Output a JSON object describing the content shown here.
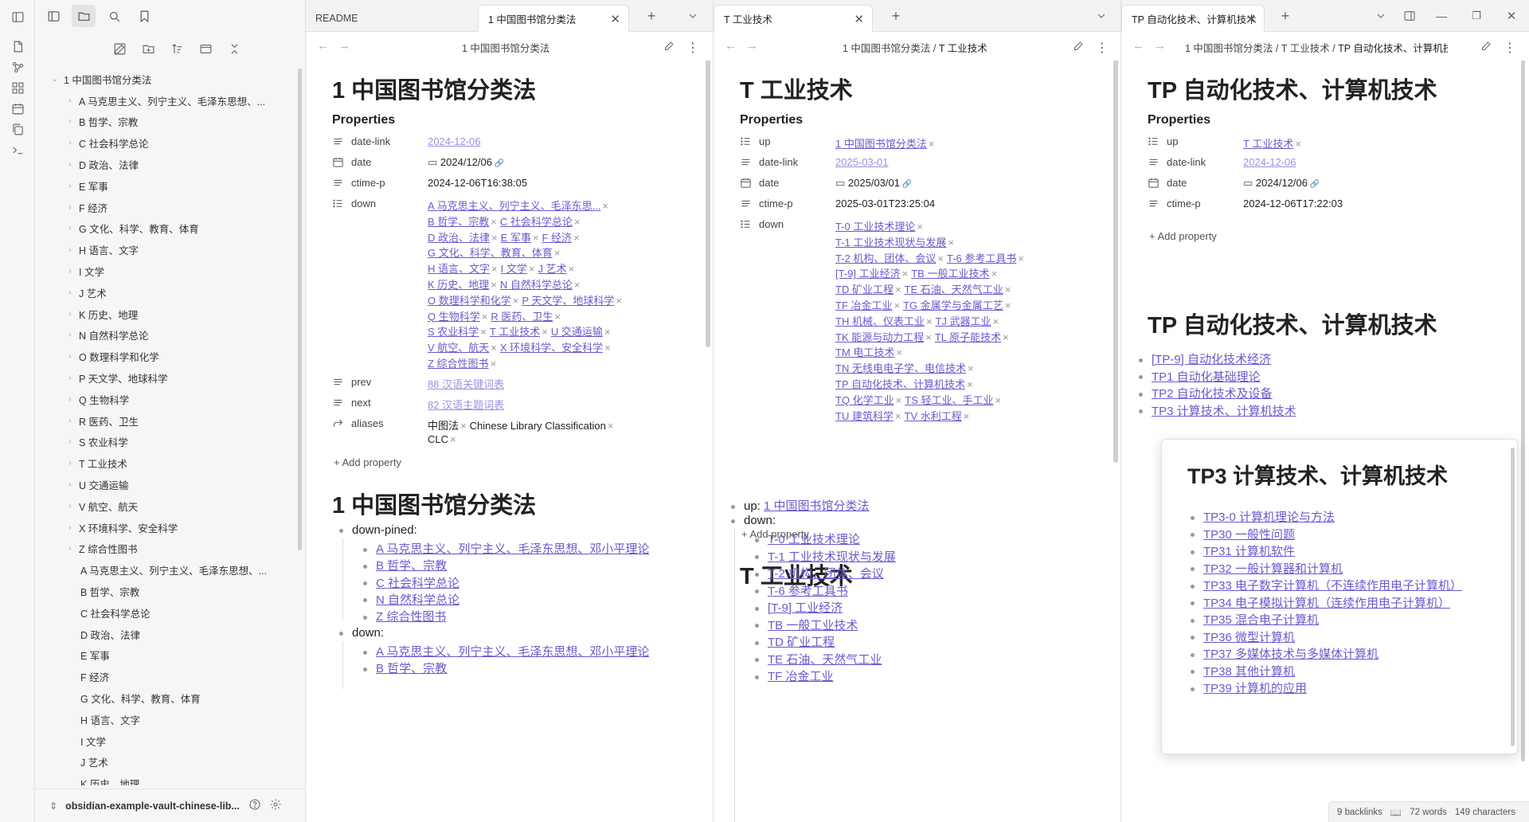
{
  "sidebar": {
    "vault_name": "obsidian-example-vault-chinese-lib...",
    "tree_root": "1 中国图书馆分类法",
    "tree_items": [
      "A 马克思主义、列宁主义、毛泽东思想、...",
      "B 哲学、宗教",
      "C 社会科学总论",
      "D 政治、法律",
      "E 军事",
      "F 经济",
      "G 文化、科学、教育、体育",
      "H 语言、文字",
      "I 文学",
      "J 艺术",
      "K 历史、地理",
      "N 自然科学总论",
      "O 数理科学和化学",
      "P 天文学、地球科学",
      "Q 生物科学",
      "R 医药、卫生",
      "S 农业科学",
      "T 工业技术",
      "U 交通运输",
      "V 航空、航天",
      "X 环境科学、安全科学",
      "Z 综合性图书"
    ],
    "tree_files": [
      "A 马克思主义、列宁主义、毛泽东思想、...",
      "B 哲学、宗教",
      "C 社会科学总论",
      "D 政治、法律",
      "E 军事",
      "F 经济",
      "G 文化、科学、教育、体育",
      "H 语言、文字",
      "I 文学",
      "J 艺术",
      "K 历史、地理"
    ]
  },
  "pane1": {
    "tabs": [
      "README",
      "1 中国图书馆分类法"
    ],
    "title": "1 中国图书馆分类法",
    "header": "1 中国图书馆分类法",
    "properties_label": "Properties",
    "props": {
      "date_link_key": "date-link",
      "date_link": "2024-12-06",
      "date_key": "date",
      "date": "2024/12/06",
      "ctime_key": "ctime-p",
      "ctime": "2024-12-06T16:38:05",
      "down_key": "down",
      "down_rows": [
        [
          "A 马克思主义、列宁主义、毛泽东思..."
        ],
        [
          "B 哲学、宗教",
          "C 社会科学总论"
        ],
        [
          "D 政治、法律",
          "E 军事",
          "F 经济"
        ],
        [
          "G 文化、科学、教育、体育"
        ],
        [
          "H 语言、文字",
          "I 文学",
          "J 艺术"
        ],
        [
          "K 历史、地理",
          "N 自然科学总论"
        ],
        [
          "O 数理科学和化学",
          "P 天文学、地球科学"
        ],
        [
          "Q 生物科学",
          "R 医药、卫生"
        ],
        [
          "S 农业科学",
          "T 工业技术",
          "U 交通运输"
        ],
        [
          "V 航空、航天",
          "X 环境科学、安全科学"
        ],
        [
          "Z 综合性图书"
        ]
      ],
      "prev_key": "prev",
      "prev": "88 汉语关键词表",
      "next_key": "next",
      "next": "82 汉语主题词表",
      "aliases_key": "aliases",
      "aliases": [
        "中图法",
        "Chinese Library Classification",
        "CLC"
      ]
    },
    "add_property": "Add property",
    "h1_2": "1 中国图书馆分类法",
    "body": {
      "down_pined": "down-pined:",
      "pined_items": [
        "A 马克思主义、列宁主义、毛泽东思想、邓小平理论",
        "B 哲学、宗教",
        "C 社会科学总论",
        "N 自然科学总论",
        "Z 综合性图书"
      ],
      "down": "down:",
      "down_items": [
        "A 马克思主义、列宁主义、毛泽东思想、邓小平理论",
        "B 哲学、宗教"
      ]
    }
  },
  "pane2": {
    "tab": "T 工业技术",
    "header_parent": "1 中国图书馆分类法",
    "sep": "/",
    "header_current": "T 工业技术",
    "title": "T 工业技术",
    "properties_label": "Properties",
    "props": {
      "up_key": "up",
      "up": "1 中国图书馆分类法",
      "date_link_key": "date-link",
      "date_link": "2025-03-01",
      "date_key": "date",
      "date": "2025/03/01",
      "ctime_key": "ctime-p",
      "ctime": "2025-03-01T23:25:04",
      "down_key": "down",
      "down_rows": [
        [
          "T-0 工业技术理论"
        ],
        [
          "T-1 工业技术现状与发展"
        ],
        [
          "T-2 机构、团体、会议",
          "T-6 参考工具书"
        ],
        [
          "[T-9] 工业经济",
          "TB 一般工业技术"
        ],
        [
          "TD 矿业工程",
          "TE 石油、天然气工业"
        ],
        [
          "TF 冶金工业",
          "TG 金属学与金属工艺"
        ],
        [
          "TH 机械、仪表工业",
          "TJ 武器工业"
        ],
        [
          "TK 能源与动力工程",
          "TL 原子能技术"
        ],
        [
          "TM 电工技术"
        ],
        [
          "TN 无线电电子学、电信技术"
        ],
        [
          "TP 自动化技术、计算机技术"
        ],
        [
          "TQ 化学工业",
          "TS 轻工业、手工业"
        ],
        [
          "TU 建筑科学",
          "TV 水利工程"
        ]
      ]
    },
    "add_property": "Add property",
    "h1_2": "T 工业技术",
    "body": {
      "up": "up:",
      "up_link": "1 中国图书馆分类法",
      "down": "down:",
      "down_items": [
        "T-0 工业技术理论",
        "T-1 工业技术现状与发展",
        "T-2 机构、团体、会议",
        "T-6 参考工具书",
        "[T-9] 工业经济",
        "TB 一般工业技术",
        "TD 矿业工程",
        "TE 石油、天然气工业",
        "TF 冶金工业"
      ]
    }
  },
  "pane3": {
    "tab": "TP 自动化技术、计算机技术",
    "header_a": "1 中国图书馆分类法",
    "header_b": "T 工业技术",
    "header_c": "TP 自动化技术、计算机技",
    "title": "TP 自动化技术、计算机技术",
    "properties_label": "Properties",
    "props": {
      "up_key": "up",
      "up": "T 工业技术",
      "date_link_key": "date-link",
      "date_link": "2024-12-06",
      "date_key": "date",
      "date": "2024/12/06",
      "ctime_key": "ctime-p",
      "ctime": "2024-12-06T17:22:03"
    },
    "add_property": "Add property",
    "h1_2": "TP 自动化技术、计算机技术",
    "body_items": [
      "[TP-9] 自动化技术经济",
      "TP1 自动化基础理论",
      "TP2 自动化技术及设备",
      "TP3 计算技术、计算机技术"
    ]
  },
  "popup": {
    "title": "TP3 计算技术、计算机技术",
    "items": [
      "TP3-0 计算机理论与方法",
      "TP30 一般性问题",
      "TP31 计算机软件",
      "TP32 一般计算器和计算机",
      "TP33 电子数字计算机（不连续作用电子计算机）",
      "TP34 电子模拟计算机（连续作用电子计算机）",
      "TP35 混合电子计算机",
      "TP36 微型计算机",
      "TP37 多媒体技术与多媒体计算机",
      "TP38 其他计算机",
      "TP39 计算机的应用"
    ]
  },
  "status": {
    "backlinks": "9 backlinks",
    "words": "72 words",
    "chars": "149 characters"
  },
  "colors": {
    "link": "#6a5acd",
    "link_muted": "#9f8fe0",
    "accent_bg": "#f6f6f6"
  }
}
